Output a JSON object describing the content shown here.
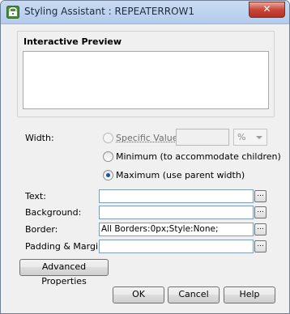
{
  "window": {
    "title": "Styling Assistant : REPEATERROW1",
    "close_glyph": "✕"
  },
  "preview_group": {
    "title": "Interactive Preview"
  },
  "width": {
    "label": "Width:",
    "options": {
      "specific": "Specific Value",
      "minimum": "Minimum (to accommodate children)",
      "maximum": "Maximum (use parent width)"
    },
    "selected": "maximum",
    "unit": "%"
  },
  "fields": {
    "text": {
      "label": "Text:",
      "value": ""
    },
    "background": {
      "label": "Background:",
      "value": ""
    },
    "border": {
      "label": "Border:",
      "value": "All Borders:0px;Style:None;"
    },
    "padding": {
      "label": "Padding & Margin:",
      "value": ""
    },
    "browse": "..."
  },
  "buttons": {
    "advanced": "Advanced Properties",
    "ok": "OK",
    "cancel": "Cancel",
    "help": "Help"
  },
  "icons": {
    "app": "styling-assistant-icon",
    "close": "close-icon"
  }
}
